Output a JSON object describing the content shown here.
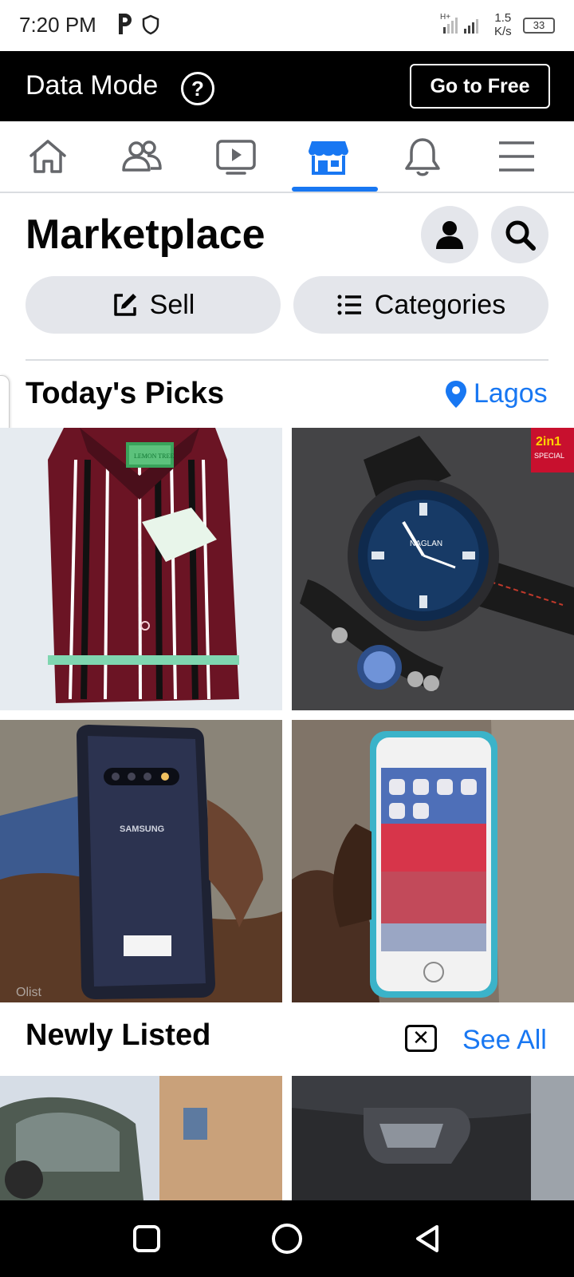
{
  "status_bar": {
    "time": "7:20 PM",
    "net_type": "H+",
    "speed_value": "1.5",
    "speed_unit": "K/s",
    "battery": "33"
  },
  "data_banner": {
    "title": "Data Mode",
    "help_symbol": "?",
    "go_free_label": "Go to Free"
  },
  "nav": {
    "items": [
      "home-icon",
      "friends-icon",
      "watch-icon",
      "marketplace-icon",
      "notifications-icon",
      "menu-icon"
    ],
    "active": "marketplace-icon",
    "active_color": "#1877f2"
  },
  "marketplace": {
    "title": "Marketplace",
    "sell_label": "Sell",
    "categories_label": "Categories"
  },
  "todays_picks": {
    "title": "Today's Picks",
    "location": "Lagos",
    "items": [
      {
        "name": "striped-shirt-image",
        "brand_tag": "LEMON TREE"
      },
      {
        "name": "watch-image",
        "brand_tag": "NAGLAN",
        "badge_top": "2in1",
        "badge_bottom": "SPECIAL"
      },
      {
        "name": "samsung-phone-image",
        "brand_tag": "SAMSUNG",
        "watermark": "Olist"
      },
      {
        "name": "iphone-image"
      }
    ]
  },
  "newly_listed": {
    "title": "Newly Listed",
    "close_symbol": "✕",
    "see_all_label": "See All",
    "items": [
      {
        "name": "car-exterior-image"
      },
      {
        "name": "car-interior-image"
      }
    ]
  },
  "colors": {
    "accent": "#1877f2",
    "button_bg": "#e4e6eb",
    "banner_bg": "#000000"
  }
}
